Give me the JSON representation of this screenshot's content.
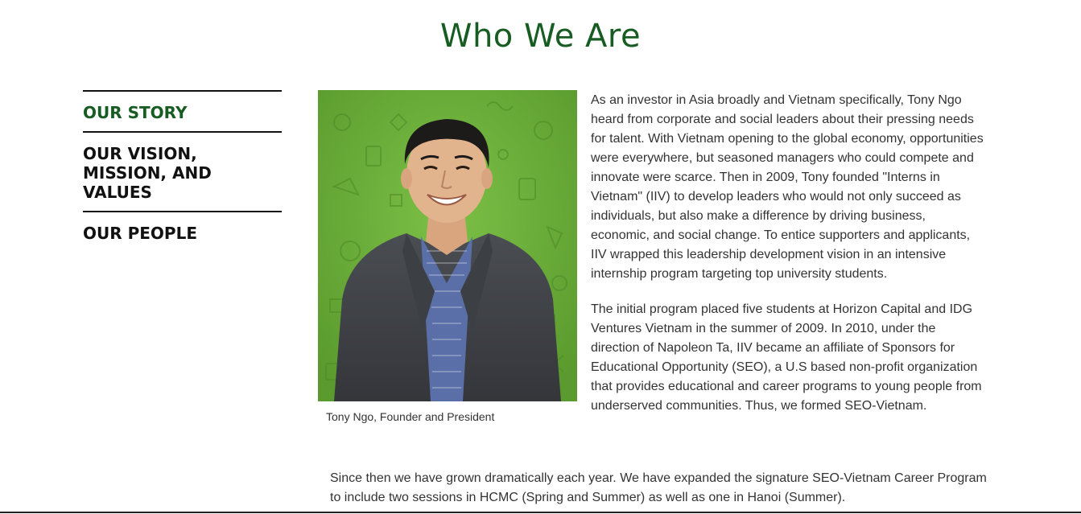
{
  "page": {
    "title": "Who We Are"
  },
  "sidenav": {
    "items": [
      {
        "label": "OUR STORY",
        "active": true
      },
      {
        "label": "OUR VISION, MISSION, AND VALUES",
        "active": false
      },
      {
        "label": "OUR PEOPLE",
        "active": false
      }
    ]
  },
  "photo": {
    "caption": "Tony Ngo, Founder and President",
    "background_color": "#6aac3a"
  },
  "story": {
    "paragraph_1": "As an investor in Asia broadly and Vietnam specifically, Tony Ngo heard from corporate and social leaders about their pressing needs for talent. With Vietnam opening to the global economy, opportunities were everywhere, but seasoned managers who could compete and innovate were scarce. Then in 2009, Tony founded \"Interns in Vietnam\" (IIV) to develop leaders who would not only succeed as individuals, but also make a difference by driving business, economic, and social change. To entice supporters and applicants, IIV wrapped this leadership development vision in an intensive internship program targeting top university students.",
    "paragraph_2": "The initial program placed five students at Horizon Capital and IDG Ventures Vietnam in the summer of 2009. In 2010, under the direction of Napoleon Ta, IIV became an affiliate of Sponsors for Educational Opportunity (SEO), a U.S based non-profit organization that provides educational and career programs to young people from underserved communities. Thus, we formed SEO-Vietnam.",
    "paragraph_3": "Since then we have grown dramatically each year. We have expanded the signature SEO-Vietnam Career Program to include two sessions in HCMC (Spring and Summer) as well as one in Hanoi (Summer)."
  },
  "colors": {
    "accent_green": "#175c22",
    "text": "#333333",
    "nav_text": "#111111"
  }
}
